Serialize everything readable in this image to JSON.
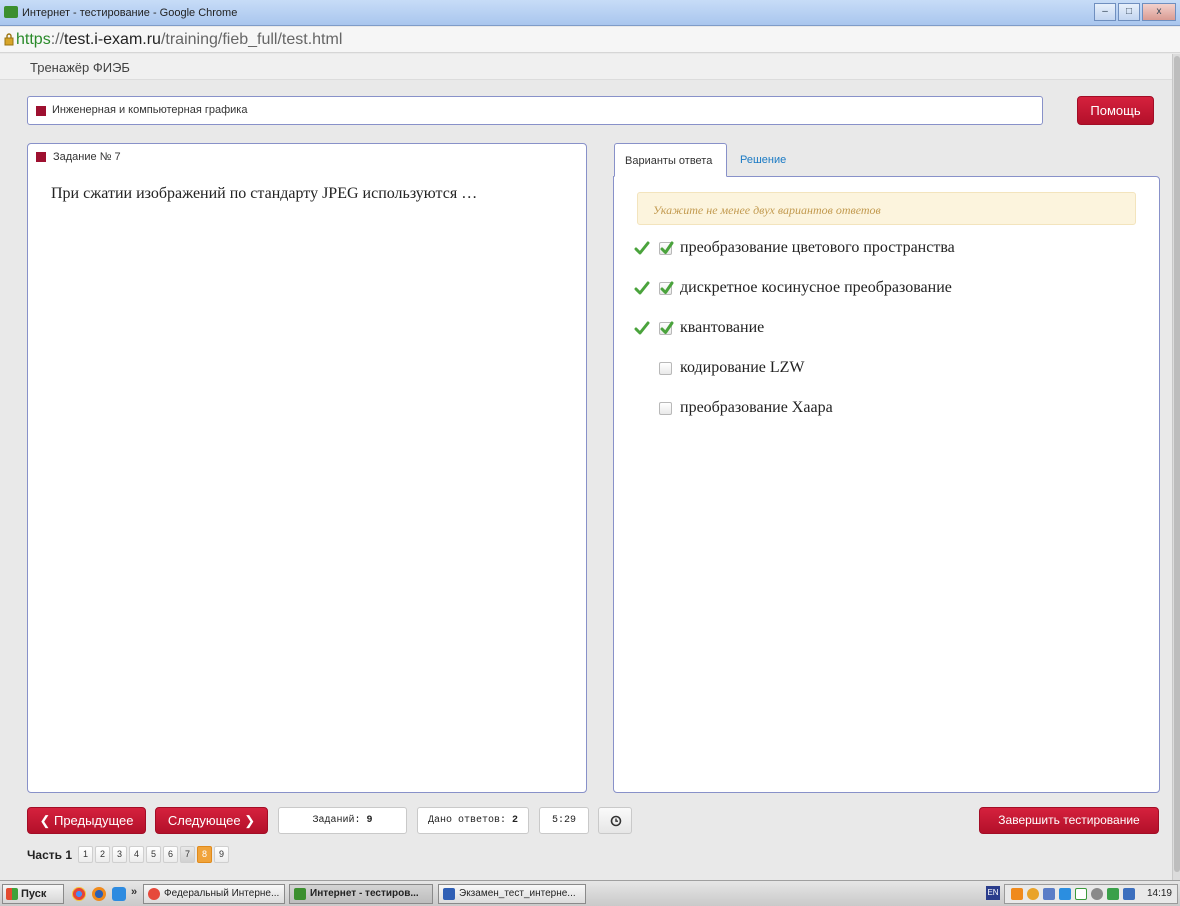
{
  "window": {
    "title": "Интернет - тестирование - Google Chrome",
    "controls": [
      "–",
      "□",
      "x"
    ]
  },
  "browser": {
    "url_scheme": "https",
    "url_sep": "://",
    "url_host": "test.i-exam.ru",
    "url_path": "/training/fieb_full/test.html"
  },
  "app": {
    "brand": "Тренажёр ФИЭБ",
    "subject": "Инженерная и компьютерная графика",
    "help_label": "Помощь"
  },
  "question": {
    "number_label": "Задание № 7",
    "text": "При сжатии изображений по стандарту JPEG используются …"
  },
  "answers": {
    "tabs": [
      {
        "label": "Варианты ответа",
        "active": true
      },
      {
        "label": "Решение",
        "active": false
      }
    ],
    "hint": "Укажите не менее двух вариантов ответов",
    "options": [
      {
        "text": "преобразование цветового пространства",
        "checked": true,
        "correct_mark": true
      },
      {
        "text": "дискретное косинусное преобразование",
        "checked": true,
        "correct_mark": true
      },
      {
        "text": "квантование",
        "checked": true,
        "correct_mark": true
      },
      {
        "text": "кодирование LZW",
        "checked": false,
        "correct_mark": false
      },
      {
        "text": "преобразование Хаара",
        "checked": false,
        "correct_mark": false
      }
    ]
  },
  "nav": {
    "prev_label": "❮ Предыдущее",
    "next_label": "Следующее ❯",
    "tasks_label": "Заданий:",
    "tasks_count": "9",
    "answered_label": "Дано ответов:",
    "answered_count": "2",
    "timer": "5:29",
    "finish_label": "Завершить тестирование",
    "part_label": "Часть 1",
    "pages": [
      {
        "n": "1",
        "state": "normal"
      },
      {
        "n": "2",
        "state": "normal"
      },
      {
        "n": "3",
        "state": "normal"
      },
      {
        "n": "4",
        "state": "normal"
      },
      {
        "n": "5",
        "state": "normal"
      },
      {
        "n": "6",
        "state": "normal"
      },
      {
        "n": "7",
        "state": "answered"
      },
      {
        "n": "8",
        "state": "current"
      },
      {
        "n": "9",
        "state": "normal"
      }
    ]
  },
  "taskbar": {
    "start_label": "Пуск",
    "more": "»",
    "tasks": [
      {
        "label": "Федеральный Интерне...",
        "active": false
      },
      {
        "label": "Интернет - тестиров...",
        "active": true
      },
      {
        "label": "Экзамен_тест_интерне...",
        "active": false
      }
    ],
    "lang": "EN",
    "clock": "14:19"
  },
  "colors": {
    "accent_red": "#b3102a",
    "panel_border": "#8891c9",
    "check_green": "#4aa33c",
    "current_page": "#f0a33a"
  }
}
